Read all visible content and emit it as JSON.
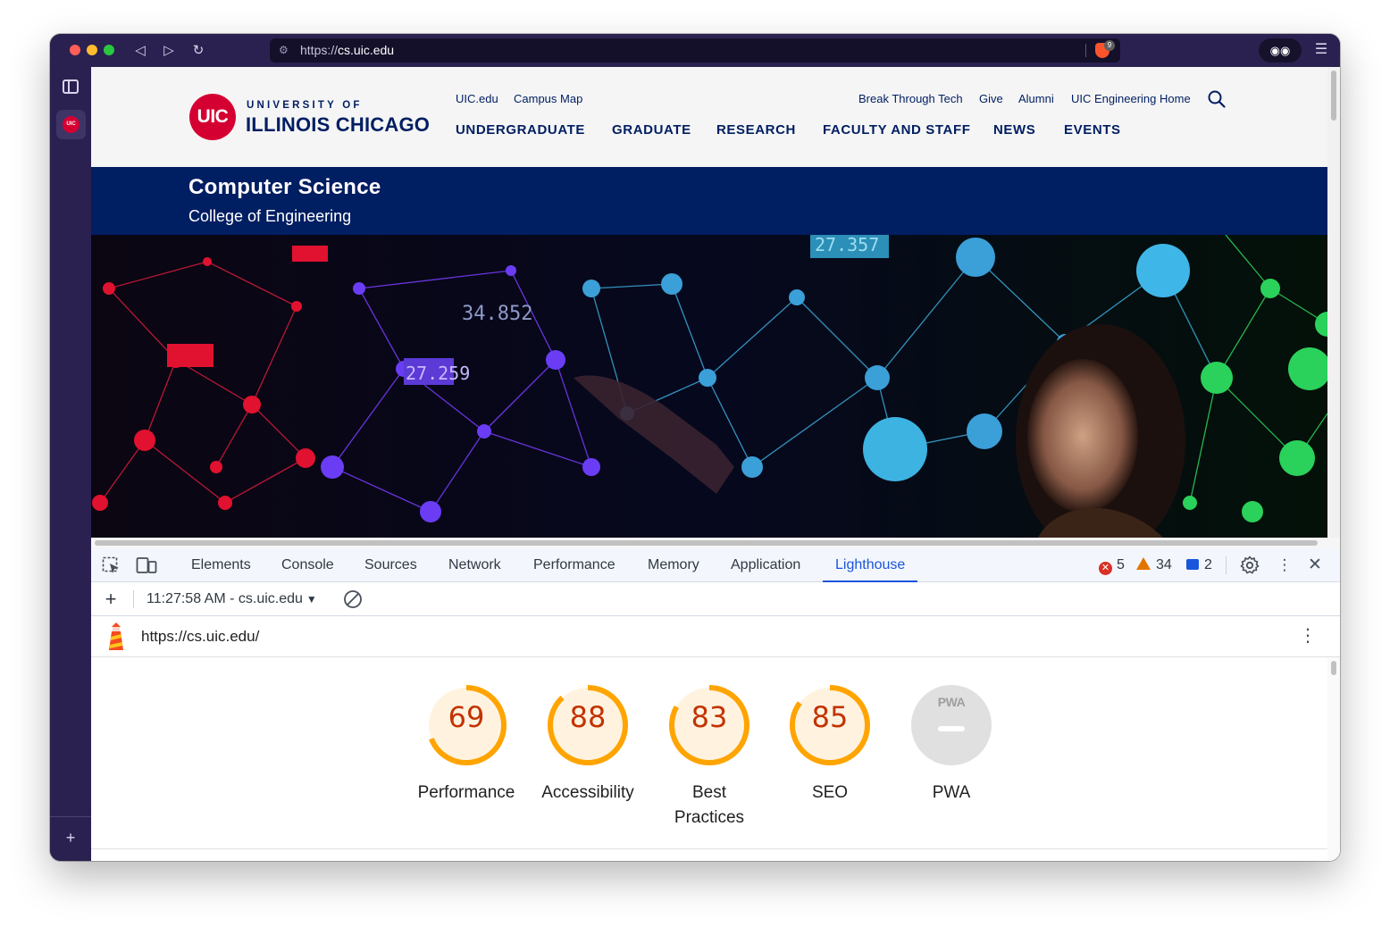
{
  "browser": {
    "url_prefix": "https://",
    "url_host": "cs.uic.edu",
    "shields_count": "9",
    "sidebar_favicon": "UIC"
  },
  "site": {
    "logo_mark": "UIC",
    "logo_top": "UNIVERSITY OF",
    "logo_bottom": "ILLINOIS CHICAGO",
    "util_links": [
      "UIC.edu",
      "Campus Map",
      "Break Through Tech",
      "Give",
      "Alumni",
      "UIC Engineering Home"
    ],
    "main_nav": [
      "UNDERGRADUATE",
      "GRADUATE",
      "RESEARCH",
      "FACULTY AND STAFF",
      "NEWS",
      "EVENTS"
    ],
    "department": "Computer Science",
    "college": "College of Engineering",
    "hero_numbers": [
      "27.357",
      "34.852",
      "27.259"
    ]
  },
  "devtools": {
    "tabs": [
      "Elements",
      "Console",
      "Sources",
      "Network",
      "Performance",
      "Memory",
      "Application",
      "Lighthouse"
    ],
    "active_tab": "Lighthouse",
    "errors": "5",
    "warnings": "34",
    "messages": "2"
  },
  "lighthouse": {
    "report_selector": "11:27:58 AM - cs.uic.edu",
    "url": "https://cs.uic.edu/",
    "scores": [
      {
        "label": "Performance",
        "value": "69",
        "fraction": 0.69
      },
      {
        "label": "Accessibility",
        "value": "88",
        "fraction": 0.88
      },
      {
        "label": "Best Practices",
        "value": "83",
        "fraction": 0.83
      },
      {
        "label": "SEO",
        "value": "85",
        "fraction": 0.85
      }
    ],
    "pwa": {
      "label": "PWA",
      "badge": "PWA"
    },
    "colors": {
      "average_ring": "#ffa400",
      "average_fill": "#fff3e0",
      "average_text": "#c33300",
      "pwa_gray": "#e0e0e0"
    }
  }
}
